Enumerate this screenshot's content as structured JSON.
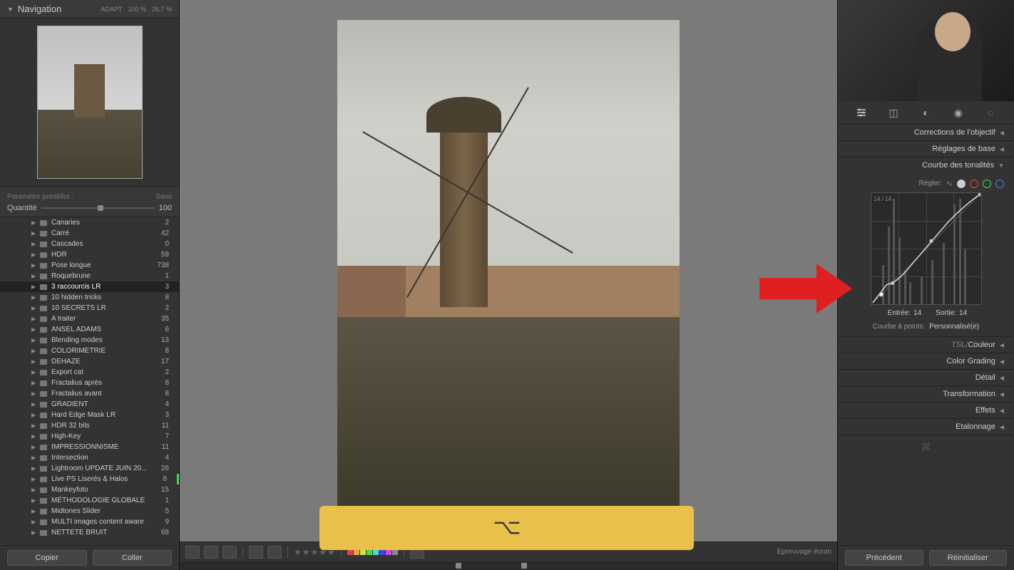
{
  "nav": {
    "title": "Navigation",
    "adapt": "ADAPT",
    "zoom1": "100 %",
    "zoom2": "26,7 %"
  },
  "preset": {
    "label": "Paramètre prédéfini :",
    "value": "Sans",
    "qty_label": "Quantité",
    "qty_value": "100"
  },
  "folders": [
    {
      "name": "Canaries",
      "count": "2"
    },
    {
      "name": "Carré",
      "count": "42"
    },
    {
      "name": "Cascades",
      "count": "0"
    },
    {
      "name": "HDR",
      "count": "59"
    },
    {
      "name": "Pose longue",
      "count": "738"
    },
    {
      "name": "Roquebrune",
      "count": "1"
    },
    {
      "name": "3 raccourcis LR",
      "count": "3",
      "selected": true
    },
    {
      "name": "10 hidden tricks",
      "count": "8"
    },
    {
      "name": "10 SECRETS LR",
      "count": "2"
    },
    {
      "name": "A traiter",
      "count": "35"
    },
    {
      "name": "ANSEL ADAMS",
      "count": "6"
    },
    {
      "name": "Blending modes",
      "count": "13"
    },
    {
      "name": "COLORIMETRIE",
      "count": "8"
    },
    {
      "name": "DEHAZE",
      "count": "17"
    },
    {
      "name": "Export cat",
      "count": "2"
    },
    {
      "name": "Fractalius après",
      "count": "8"
    },
    {
      "name": "Fractalius avant",
      "count": "8"
    },
    {
      "name": "GRADIENT",
      "count": "4"
    },
    {
      "name": "Hard Edge Mask LR",
      "count": "3"
    },
    {
      "name": "HDR 32 bits",
      "count": "11"
    },
    {
      "name": "High-Key",
      "count": "7"
    },
    {
      "name": "IMPRESSIONNISME",
      "count": "11"
    },
    {
      "name": "Intersection",
      "count": "4"
    },
    {
      "name": "Lightroom UPDATE JUIN 20...",
      "count": "26"
    },
    {
      "name": "Live PS Liserés & Halos",
      "count": "8",
      "marker": true
    },
    {
      "name": "Mankeyfoto",
      "count": "15"
    },
    {
      "name": "MÉTHODOLOGIE GLOBALE",
      "count": "1"
    },
    {
      "name": "Midtones Slider",
      "count": "5"
    },
    {
      "name": "MULTI images content aware",
      "count": "9"
    },
    {
      "name": "NETTETE BRUIT",
      "count": "68"
    }
  ],
  "buttons": {
    "copy": "Copier",
    "paste": "Coller",
    "prev": "Précédent",
    "reset": "Réinitialiser"
  },
  "toolbar": {
    "proof": "Epreuvage écran"
  },
  "panels": {
    "lens": "Corrections de l'objectif",
    "basic": "Réglages de base",
    "curve": "Courbe des tonalités",
    "tsl": "TSL",
    "color": "Couleur",
    "grading": "Color Grading",
    "detail": "Détail",
    "transform": "Transformation",
    "effects": "Effets",
    "calib": "Etalonnage"
  },
  "curve": {
    "adjust": "Régler:",
    "coord": "14 / 14",
    "in_label": "Entrée:",
    "in_val": "14",
    "out_label": "Sortie:",
    "out_val": "14",
    "points_label": "Courbe à points:",
    "points_val": "Personnalisé(e)"
  },
  "swatch_colors": [
    "#d44",
    "#da4",
    "#dd4",
    "#4d4",
    "#4dd",
    "#44d",
    "#d4d",
    "#888"
  ]
}
